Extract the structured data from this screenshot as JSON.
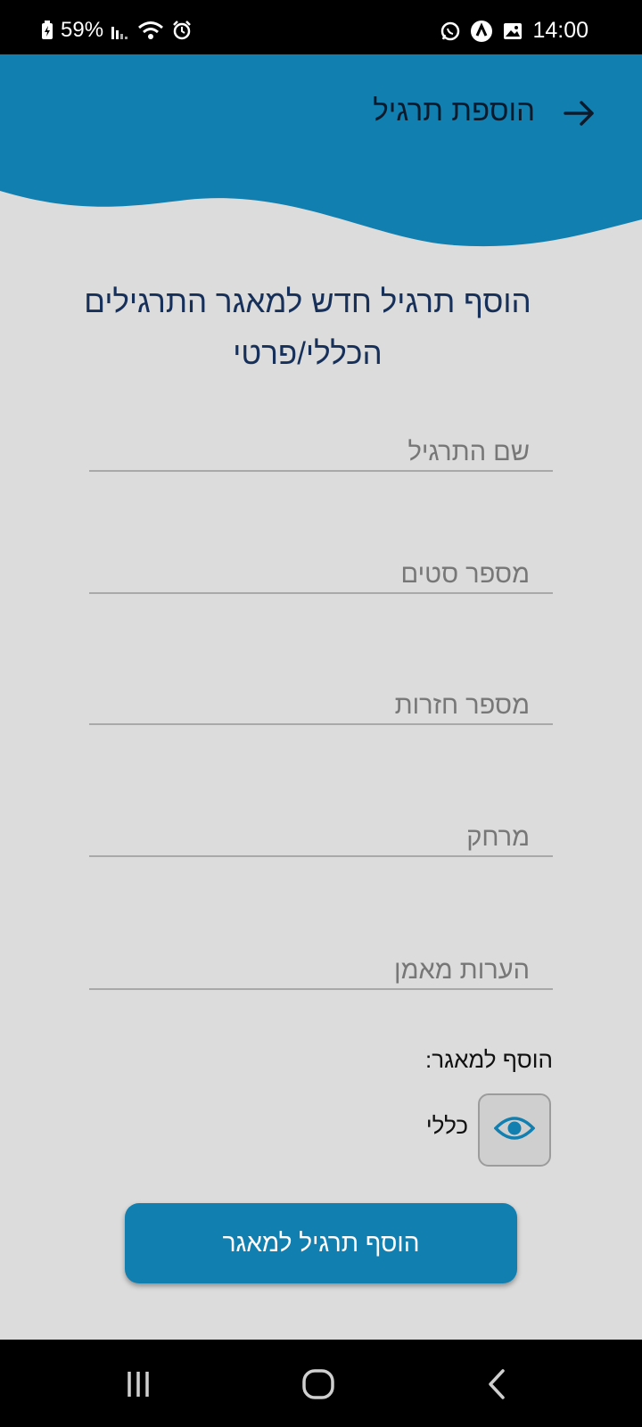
{
  "status_bar": {
    "battery": "59%",
    "time": "14:00",
    "icons": [
      "battery-charging-icon",
      "signal-icon",
      "wifi-icon",
      "alarm-icon",
      "whatsapp-icon",
      "notification-a-icon",
      "gallery-icon"
    ]
  },
  "header": {
    "title": "הוספת תרגיל",
    "back_icon": "arrow-right-icon",
    "color": "#1180b0"
  },
  "main": {
    "heading": "הוסף תרגיל חדש למאגר התרגילים הכללי/פרטי"
  },
  "form": {
    "fields": [
      {
        "placeholder": "שם התרגיל",
        "value": ""
      },
      {
        "placeholder": "מספר סטים",
        "value": ""
      },
      {
        "placeholder": "מספר חזרות",
        "value": ""
      },
      {
        "placeholder": "מרחק",
        "value": ""
      },
      {
        "placeholder": "הערות מאמן",
        "value": ""
      }
    ],
    "pool_label": "הוסף למאגר:",
    "visibility_icon": "eye-icon",
    "general_label": "כללי",
    "submit_label": "הוסף תרגיל למאגר"
  },
  "nav_bar": {
    "icons": [
      "recents-icon",
      "home-icon",
      "back-icon"
    ]
  },
  "colors": {
    "accent": "#1180b0",
    "background": "#dcdcdc",
    "heading": "#17305a"
  }
}
